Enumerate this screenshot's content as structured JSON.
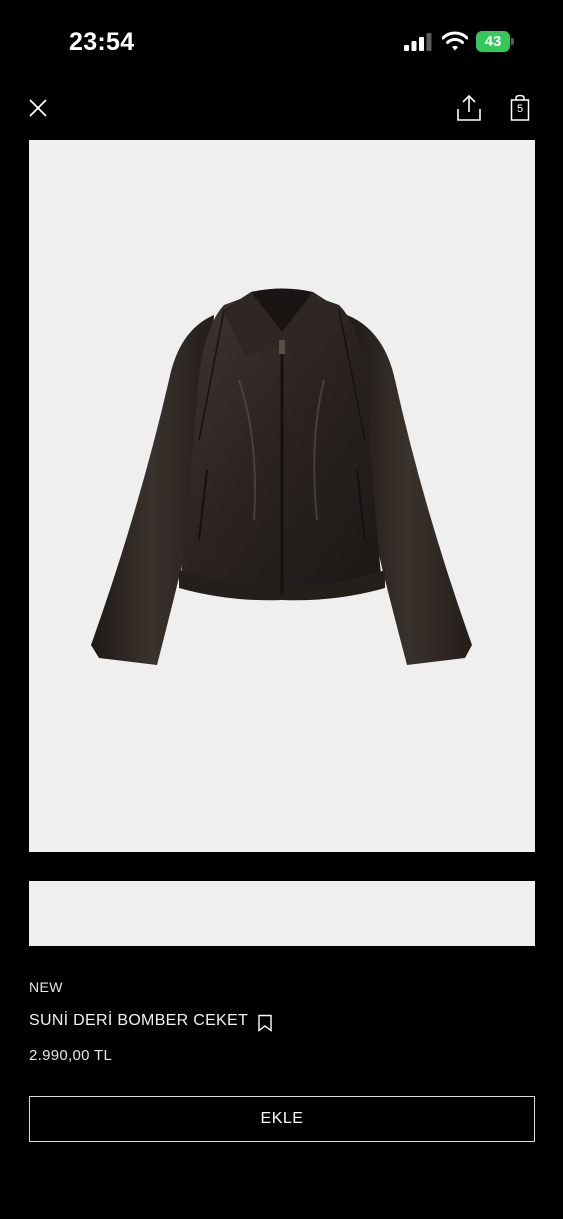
{
  "status_bar": {
    "time": "23:54",
    "battery_percent": "43",
    "signal_icon": "cellular-signal-icon",
    "wifi_icon": "wifi-icon",
    "battery_color": "#34c759"
  },
  "toolbar": {
    "close_icon": "close-icon",
    "share_icon": "share-icon",
    "bag_icon": "shopping-bag-icon",
    "bag_count": "5"
  },
  "product": {
    "badge": "NEW",
    "name": "SUNİ DERİ BOMBER CEKET",
    "price": "2.990,00 TL",
    "bookmark_icon": "bookmark-icon",
    "image": "brown-faux-leather-bomber-jacket",
    "image_background": "#efefef"
  },
  "actions": {
    "add_label": "EKLE"
  }
}
